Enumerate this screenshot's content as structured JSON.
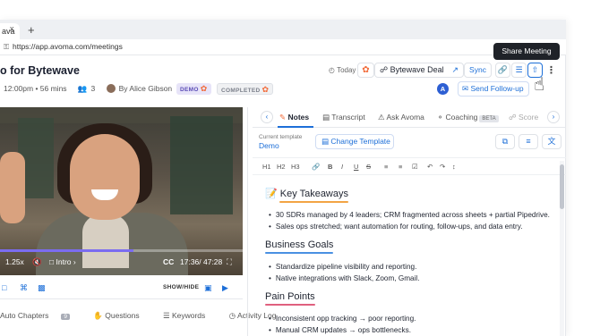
{
  "browser": {
    "tab_close": "x",
    "new_tab": "+",
    "lock": "⚿",
    "url": "https://app.avoma.com/meetings"
  },
  "header": {
    "title": "o for Bytewave",
    "time": "12:00pm • 56 mins",
    "attendees": "3",
    "by": "By Alice Gibson",
    "badge_demo": "DEMO",
    "badge_completed": "COMPLETED",
    "today": "Today",
    "deal_label": "Bytewave Deal",
    "sync_label": "Sync",
    "tooltip": "Share Meeting",
    "avatar_initial": "A",
    "send_followup": "Send Follow-up"
  },
  "video": {
    "speed": "1.25x",
    "chapter": "Intro",
    "cc": "CC",
    "time": "17:36/ 47:28",
    "progress": 0.55,
    "show_hide": "SHOW/HIDE"
  },
  "left_tabs": [
    {
      "label": "Auto Chapters",
      "count": "9"
    },
    {
      "label": "Questions"
    },
    {
      "label": "Keywords"
    },
    {
      "label": "Activity Log"
    }
  ],
  "right_tabs": {
    "notes": "Notes",
    "transcript": "Transcript",
    "ask": "Ask Avoma",
    "coaching": "Coaching",
    "beta": "BETA",
    "score": "Score"
  },
  "template": {
    "label": "Current template",
    "value": "Demo",
    "change": "Change Template"
  },
  "toolbar": [
    "H1",
    "H2",
    "H3"
  ],
  "notes": {
    "sections": [
      {
        "title": "Key Takeaways",
        "emoji": "📝",
        "color": "#f2a444",
        "bullets": [
          "30 SDRs managed by 4 leaders; CRM fragmented across sheets + partial Pipedrive.",
          "Sales ops stretched; want automation for routing, follow-ups, and data entry."
        ]
      },
      {
        "title": "Business Goals",
        "color": "#4a90e2",
        "bullets": [
          "Standardize pipeline visibility and reporting.",
          "Native integrations with Slack, Zoom, Gmail."
        ]
      },
      {
        "title": "Pain Points",
        "color": "#e0607e",
        "bullets": [
          "Inconsistent opp tracking → poor reporting.",
          "Manual CRM updates → ops bottlenecks."
        ]
      }
    ]
  },
  "colors": {
    "accent": "#1d6fd8",
    "hubspot": "#f26b3a",
    "progress": "#7b6cf0"
  }
}
